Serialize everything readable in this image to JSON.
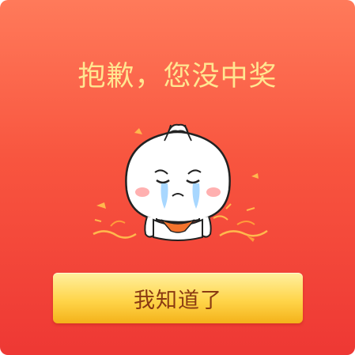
{
  "dialog": {
    "title": "抱歉，您没中奖",
    "mascot_icon": "crying-bun-mascot",
    "button_label": "我知道了"
  },
  "colors": {
    "background_top": "#ff7a5a",
    "background_bottom": "#ee3834",
    "title": "#ffe691",
    "button": "#ffd54a",
    "button_text": "#8a3a12"
  }
}
